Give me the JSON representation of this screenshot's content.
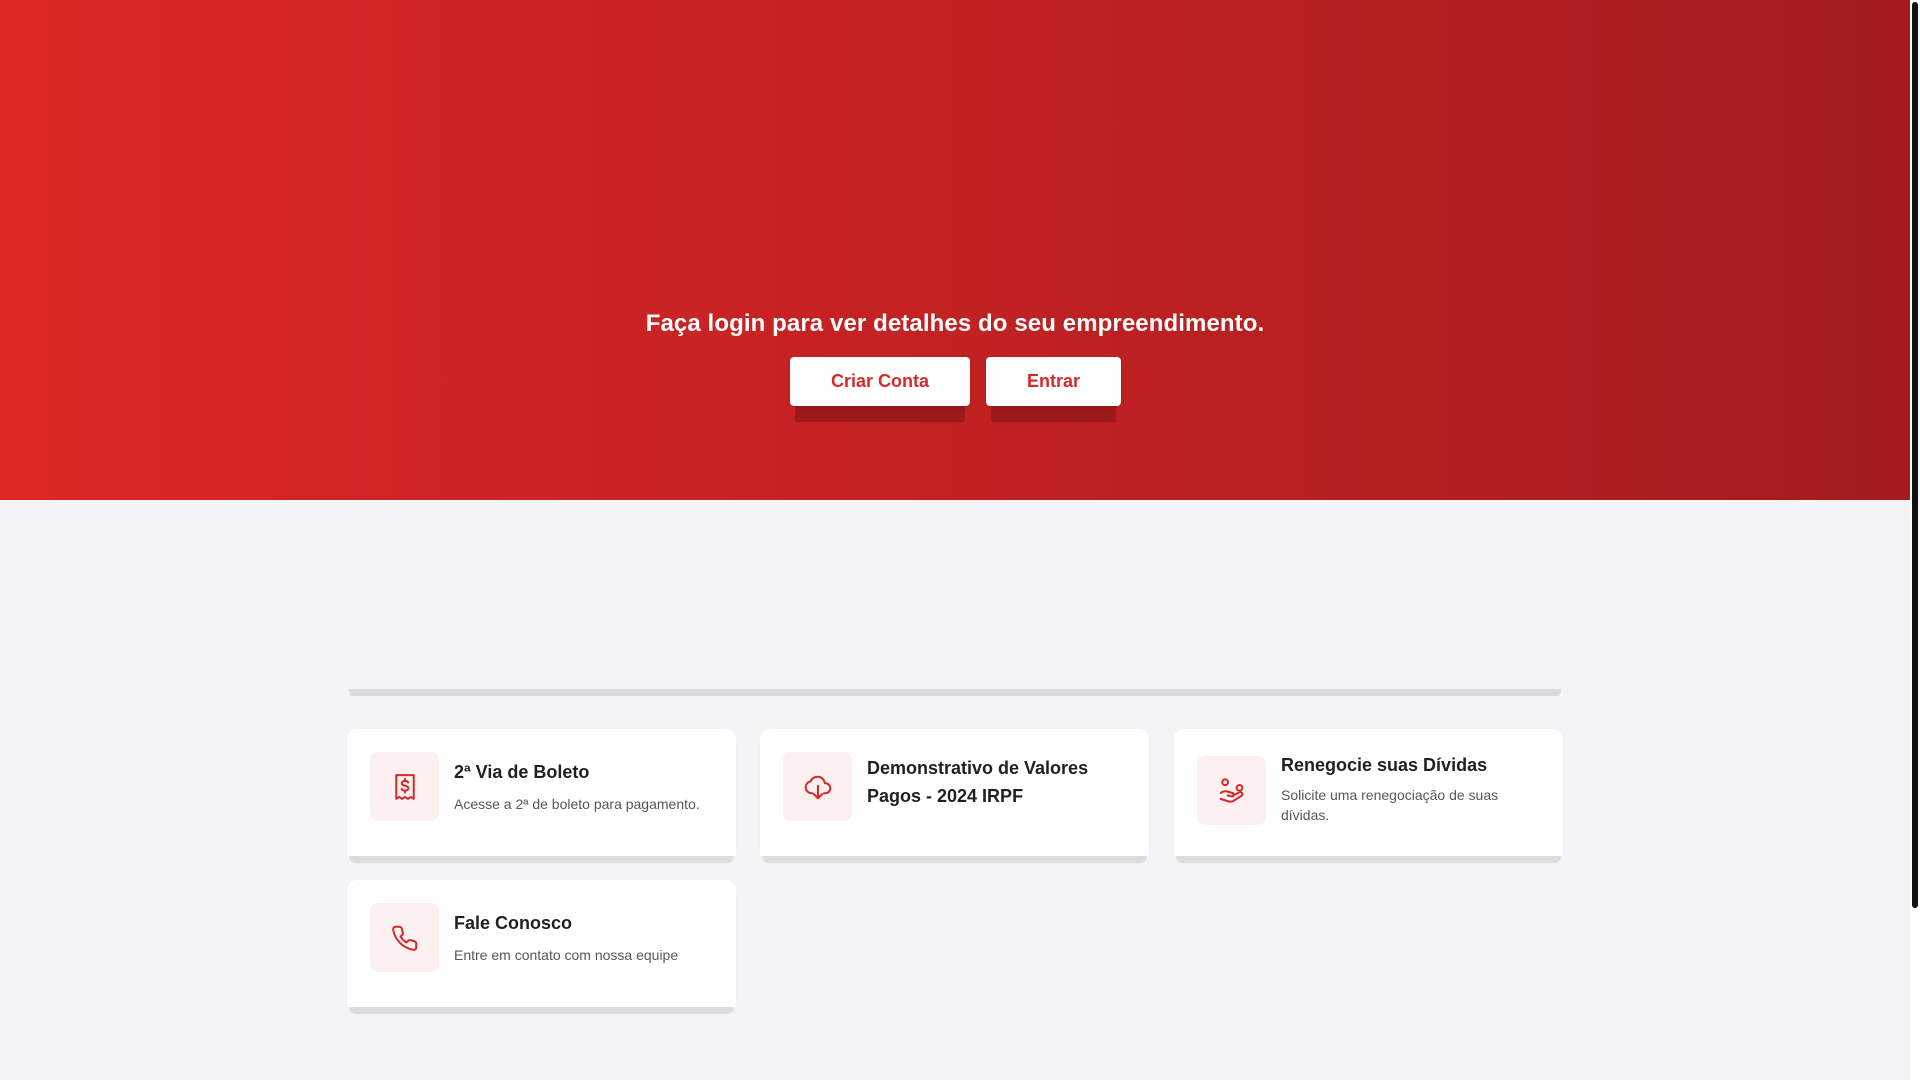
{
  "hero": {
    "title": "Faça login para ver detalhes do seu empreendimento.",
    "create_account_label": "Criar Conta",
    "login_label": "Entrar"
  },
  "cards": [
    {
      "title": "2ª Via de Boleto",
      "description": "Acesse a 2ª de boleto para pagamento.",
      "icon": "receipt-dollar-icon"
    },
    {
      "title": "Demonstrativo de Valores Pagos - 2024 IRPF",
      "description": "",
      "icon": "cloud-download-icon"
    },
    {
      "title": "Renegocie suas Dívidas",
      "description": "Solicite uma renegociação de suas dívidas.",
      "icon": "hand-coins-icon"
    },
    {
      "title": "Fale Conosco",
      "description": "Entre em contato com nossa equipe",
      "icon": "phone-icon"
    }
  ],
  "colors": {
    "brand_red": "#d32a2a",
    "hero_gradient_start": "#dd2726",
    "hero_gradient_end": "#a51c1e",
    "icon_bg": "#fdf0f0",
    "page_bg": "#f4f4f6"
  }
}
